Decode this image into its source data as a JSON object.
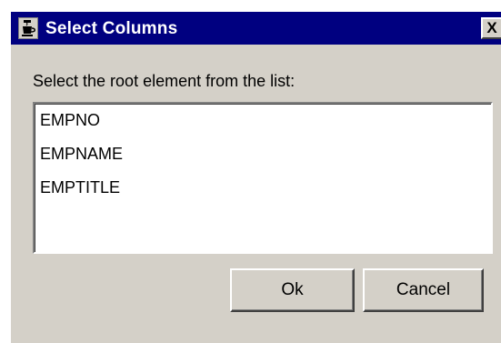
{
  "window": {
    "title": "Select Columns",
    "close_glyph": "X",
    "icon": "java-coffee-cup-icon"
  },
  "prompt": "Select the root element from the list:",
  "list": {
    "items": [
      "EMPNO",
      "EMPNAME",
      "EMPTITLE"
    ]
  },
  "buttons": {
    "ok_label": "Ok",
    "cancel_label": "Cancel"
  },
  "colors": {
    "titlebar": "#000080",
    "dialog_bg": "#d4d0c8",
    "list_bg": "#ffffff"
  }
}
